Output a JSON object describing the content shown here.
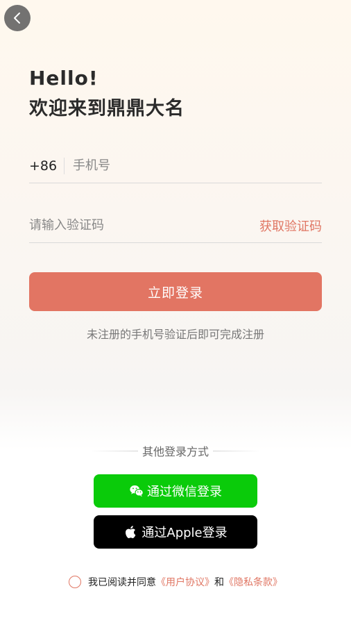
{
  "header": {
    "back_icon": "chevron-left-icon"
  },
  "greeting": {
    "hello": "Hello!",
    "welcome": "欢迎来到鼎鼎大名"
  },
  "phone": {
    "country_code": "+86",
    "placeholder": "手机号",
    "value": ""
  },
  "code": {
    "placeholder": "请输入验证码",
    "value": "",
    "get_code_label": "获取验证码"
  },
  "login_button": "立即登录",
  "notice": "未注册的手机号验证后即可完成注册",
  "other_login": {
    "title": "其他登录方式",
    "wechat_label": "通过微信登录",
    "apple_label": "通过Apple登录"
  },
  "agreement": {
    "prefix": "我已阅读并同意",
    "user_agreement": "《用户协议》",
    "and": "和",
    "privacy_policy": "《隐私条款》",
    "checked": false
  },
  "colors": {
    "accent": "#e27563",
    "wechat": "#0acb0a",
    "apple": "#000000"
  }
}
